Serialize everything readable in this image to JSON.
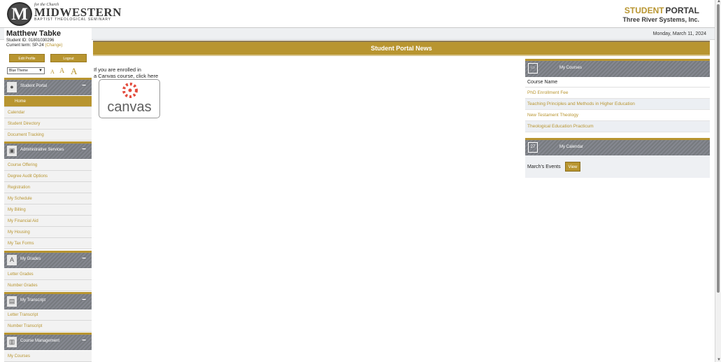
{
  "header": {
    "logo_letter": "M",
    "logo_small": "for the Church",
    "logo_big": "MIDWESTERN",
    "logo_subtitle": "BAPTIST THEOLOGICAL SEMINARY",
    "brand_student": "STUDENT",
    "brand_portal": "PORTAL",
    "brand_company": "Three River Systems, Inc.",
    "date": "Monday, March 11, 2024"
  },
  "user": {
    "name": "Matthew Tabke",
    "student_id_label": "Student ID: 01801030296",
    "term_label": "Current term: SP-24",
    "change_label": "(Change)",
    "edit_profile": "Edit Profile",
    "logout": "Logout",
    "theme": "Blue Theme",
    "font_small": "A",
    "font_medium": "A",
    "font_large": "A"
  },
  "sidebar": {
    "student_portal": "Student Portal",
    "home": "Home",
    "calendar": "Calendar",
    "student_directory": "Student Directory",
    "document_tracking": "Document Tracking",
    "admin_services": "Administrative Services",
    "course_offering": "Course Offering",
    "degree_audit": "Degree Audit Options",
    "registration": "Registration",
    "my_schedule": "My Schedule",
    "my_billing": "My Billing",
    "my_financial_aid": "My Financial Aid",
    "my_housing": "My Housing",
    "my_tax_forms": "My Tax Forms",
    "my_grades": "My Grades",
    "letter_grades": "Letter Grades",
    "number_grades": "Number Grades",
    "my_transcript": "My Transcript",
    "letter_transcript": "Letter Transcript",
    "number_transcript": "Number Transcript",
    "course_management": "Course Management",
    "my_courses": "My Courses",
    "grades_icon": "A",
    "calendar_icon_number": "27"
  },
  "main": {
    "banner": "Student Portal News",
    "canvas_line1": "If you are enrolled in",
    "canvas_line2": "a Canvas course, click here",
    "canvas_word": "canvas"
  },
  "courses": {
    "title": "My Courses",
    "column": "Course Name",
    "items": [
      "PhD Enrollment Fee",
      "Teaching Principles and Methods in Higher Education",
      "New Testament Theology",
      "Theological Education Practicum"
    ]
  },
  "calendar": {
    "title": "My Calendar",
    "events_label": "March's Events",
    "view_label": "View"
  },
  "colors": {
    "gold": "#b89530",
    "gray": "#7d8086"
  }
}
